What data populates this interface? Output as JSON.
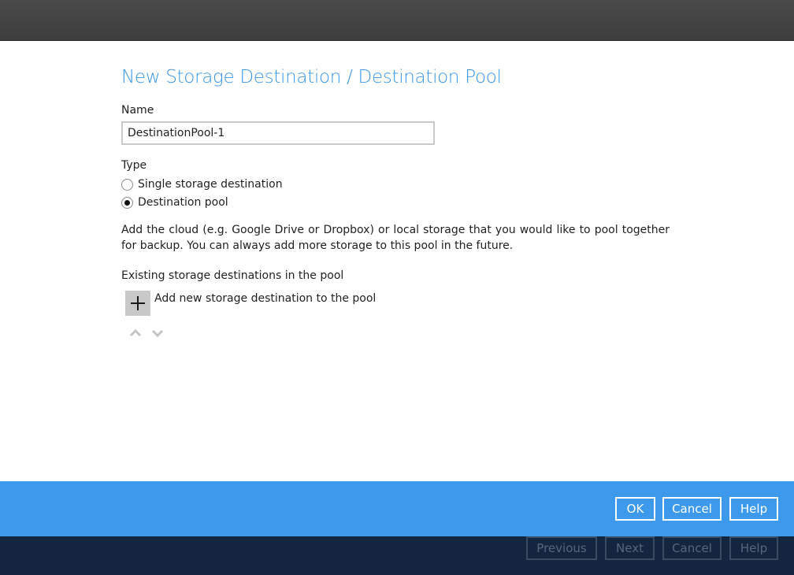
{
  "dialog": {
    "title": "New Storage Destination / Destination Pool",
    "name_label": "Name",
    "name_value": "DestinationPool-1",
    "type_label": "Type",
    "type_options": [
      {
        "label": "Single storage destination",
        "selected": false
      },
      {
        "label": "Destination pool",
        "selected": true
      }
    ],
    "description": "Add the cloud (e.g. Google Drive or Dropbox) or local storage that you would like to pool together for backup. You can always add more storage to this pool in the future.",
    "existing_label": "Existing storage destinations in the pool",
    "add_label": "Add new storage destination to the pool",
    "ok_label": "OK",
    "cancel_label": "Cancel",
    "help_label": "Help"
  },
  "wizard": {
    "previous_label": "Previous",
    "next_label": "Next",
    "cancel_label": "Cancel",
    "help_label": "Help"
  },
  "colors": {
    "accent": "#3b96e8",
    "footer_blue": "#3d99ec",
    "footer_dark": "#14253f",
    "topbar": "#424242"
  }
}
